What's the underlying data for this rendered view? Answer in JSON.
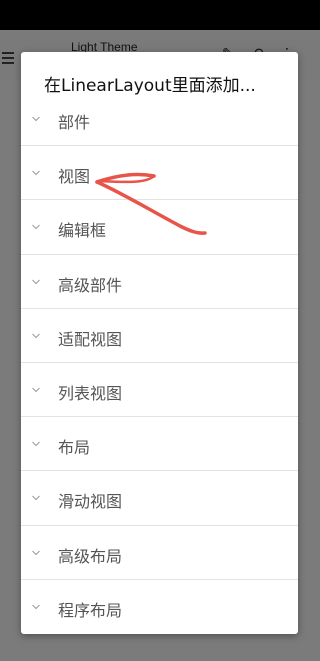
{
  "app_bar": {
    "title": "Light Theme",
    "icons": [
      "menu-icon",
      "brush-icon",
      "undo-icon",
      "more-icon"
    ]
  },
  "dialog": {
    "title": "在LinearLayout里面添加...",
    "items": [
      {
        "label": "部件"
      },
      {
        "label": "视图"
      },
      {
        "label": "编辑框"
      },
      {
        "label": "高级部件"
      },
      {
        "label": "适配视图"
      },
      {
        "label": "列表视图"
      },
      {
        "label": "布局"
      },
      {
        "label": "滑动视图"
      },
      {
        "label": "高级布局"
      },
      {
        "label": "程序布局"
      }
    ]
  },
  "colors": {
    "annotation": "#e8534a",
    "overlay": "#7b7b7b",
    "dialog_bg": "#ffffff",
    "item_text": "#555555",
    "chevron": "#9a9a9a"
  }
}
